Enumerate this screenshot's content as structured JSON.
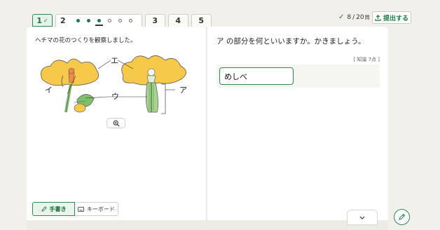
{
  "tabs": {
    "q1_label": "1",
    "q1_check": "✓",
    "q2_label": "2",
    "q2_dots": [
      "filled",
      "filled",
      "filled-current",
      "empty",
      "empty",
      "empty"
    ],
    "q3_label": "3",
    "q4_label": "4",
    "q5_label": "5"
  },
  "progress": {
    "done": "8",
    "sep": "/",
    "total": "20",
    "unit": "問"
  },
  "submit_label": "提出する",
  "left": {
    "prompt": "ヘチマの花のつくりを観察しました。",
    "labels": {
      "a": "ア",
      "i": "イ",
      "u": "ウ",
      "e": "エ"
    }
  },
  "right": {
    "question": "ア の部分を何といいますか。かきましょう。",
    "score": "[ 知識 7点 ]",
    "answer_value": "めしべ"
  },
  "modes": {
    "handwriting": "手書き",
    "keyboard": "キーボード"
  },
  "colors": {
    "accent": "#2c8a4f",
    "petal": "#f6c94a",
    "stem": "#7fbf6a"
  }
}
